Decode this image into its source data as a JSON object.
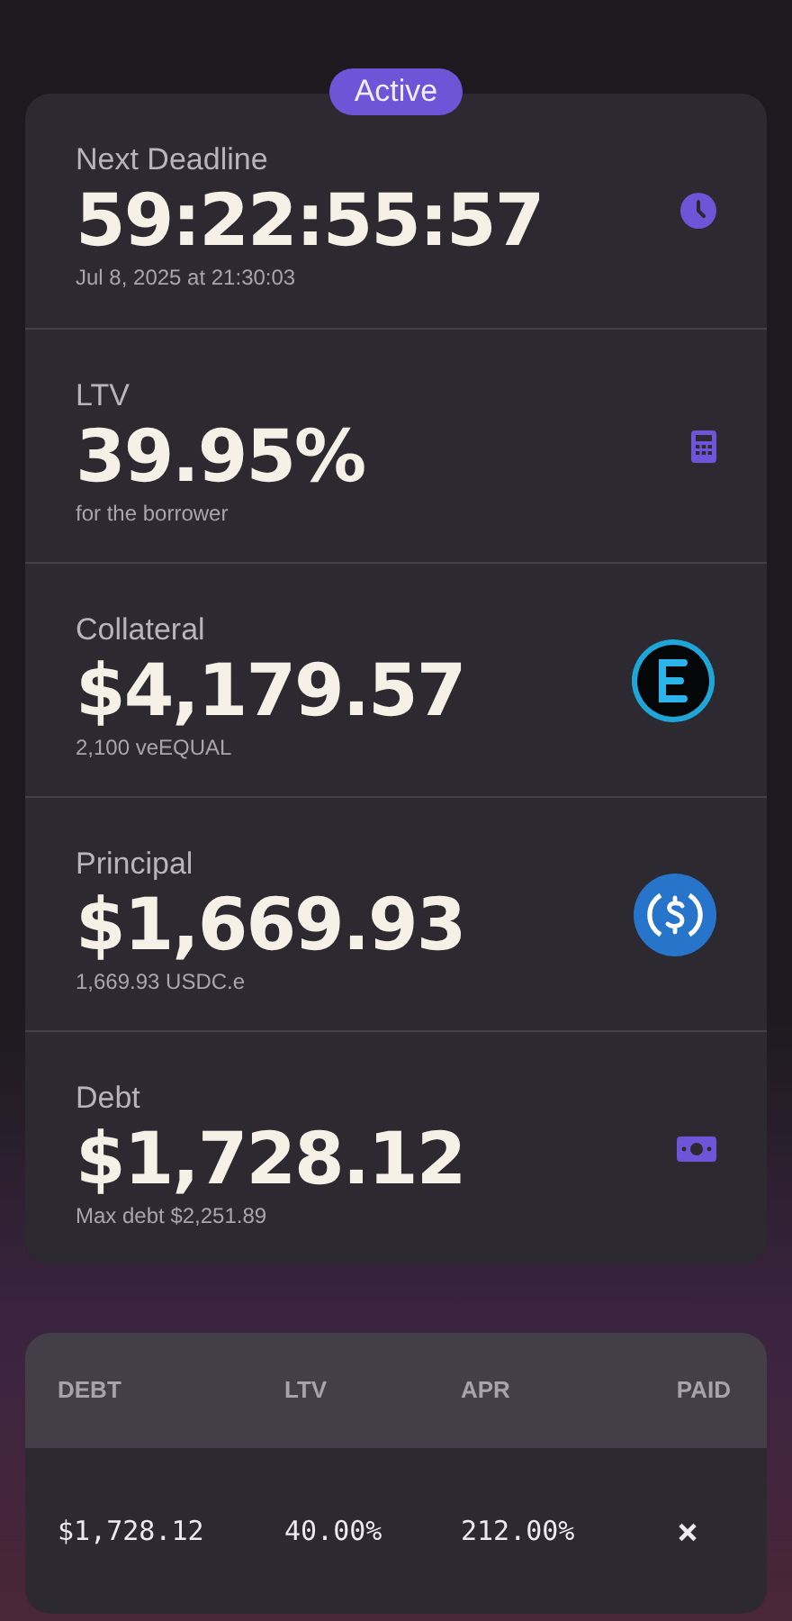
{
  "status_badge": "Active",
  "stats": [
    {
      "label": "Next Deadline",
      "value": "59:22:55:57",
      "note": "Jul 8, 2025 at 21:30:03"
    },
    {
      "label": "LTV",
      "value": "39.95%",
      "note": "for the borrower"
    },
    {
      "label": "Collateral",
      "value": "$4,179.57",
      "note": "2,100 veEQUAL"
    },
    {
      "label": "Principal",
      "value": "$1,669.93",
      "note": "1,669.93 USDC.e"
    },
    {
      "label": "Debt",
      "value": "$1,728.12",
      "note": "Max debt $2,251.89"
    }
  ],
  "table": {
    "columns": [
      "DEBT",
      "LTV",
      "APR",
      "PAID"
    ],
    "rows": [
      {
        "cells": [
          "$1,728.12",
          "40.00%",
          "212.00%",
          "×"
        ]
      }
    ]
  }
}
